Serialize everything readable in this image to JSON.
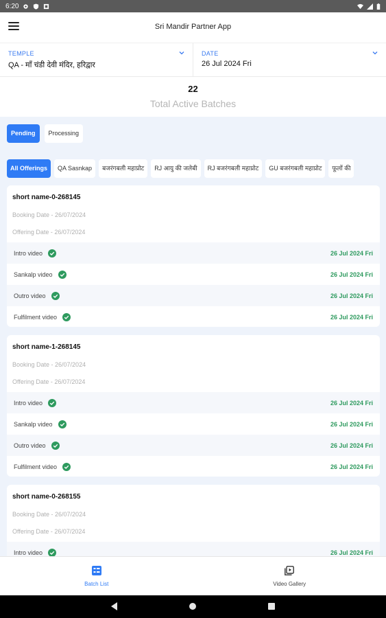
{
  "status_bar": {
    "time": "6:20"
  },
  "app_bar": {
    "title": "Sri Mandir Partner App",
    "menu_icon": "hamburger-menu-icon"
  },
  "temple_selector": {
    "label": "TEMPLE",
    "value": "QA - माँ चंडी देवी मंदिर, हरिद्वार"
  },
  "date_selector": {
    "label": "DATE",
    "value": "26 Jul 2024 Fri"
  },
  "summary": {
    "count": "22",
    "label": "Total Active Batches"
  },
  "status_tabs": [
    {
      "label": "Pending",
      "active": true
    },
    {
      "label": "Processing",
      "active": false
    }
  ],
  "offering_filters": [
    {
      "label": "All Offerings",
      "active": true
    },
    {
      "label": "QA Sasnkap",
      "active": false
    },
    {
      "label": "बजरंगबली महाप्रोट",
      "active": false
    },
    {
      "label": "RJ आयु की जलेबी",
      "active": false
    },
    {
      "label": "RJ बजरंगबली महाप्रोट",
      "active": false
    },
    {
      "label": "GU बजरंगबली महाप्रोट",
      "active": false
    },
    {
      "label": "फूलों की",
      "active": false
    }
  ],
  "batches": [
    {
      "name": "short name-0-268145",
      "booking_date": "Booking Date - 26/07/2024",
      "offering_date": "Offering Date - 26/07/2024",
      "videos": [
        {
          "label": "Intro video",
          "date": "26 Jul 2024 Fri"
        },
        {
          "label": "Sankalp video",
          "date": "26 Jul 2024 Fri"
        },
        {
          "label": "Outro video",
          "date": "26 Jul 2024 Fri"
        },
        {
          "label": "Fulfilment video",
          "date": "26 Jul 2024 Fri"
        }
      ]
    },
    {
      "name": "short name-1-268145",
      "booking_date": "Booking Date - 26/07/2024",
      "offering_date": "Offering Date - 26/07/2024",
      "videos": [
        {
          "label": "Intro video",
          "date": "26 Jul 2024 Fri"
        },
        {
          "label": "Sankalp video",
          "date": "26 Jul 2024 Fri"
        },
        {
          "label": "Outro video",
          "date": "26 Jul 2024 Fri"
        },
        {
          "label": "Fulfilment video",
          "date": "26 Jul 2024 Fri"
        }
      ]
    },
    {
      "name": "short name-0-268155",
      "booking_date": "Booking Date - 26/07/2024",
      "offering_date": "Offering Date - 26/07/2024",
      "videos": [
        {
          "label": "Intro video",
          "date": "26 Jul 2024 Fri"
        }
      ]
    }
  ],
  "bottom_nav": [
    {
      "label": "Batch List",
      "icon": "batch-list-icon",
      "active": true
    },
    {
      "label": "Video Gallery",
      "icon": "video-gallery-icon",
      "active": false
    }
  ],
  "colors": {
    "accent": "#2f7bf5",
    "success": "#2e9a5e",
    "content_bg": "#eef3fb",
    "status_bar": "#5a5a5a"
  }
}
